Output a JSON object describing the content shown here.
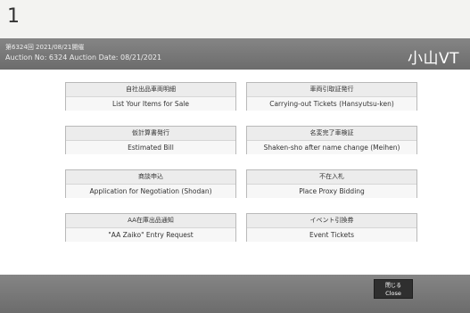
{
  "page_number": "1",
  "header": {
    "line1": "第6324回 2021/08/21開催",
    "line2": "Auction No: 6324   Auction Date: 08/21/2021",
    "venue": "小山VT"
  },
  "menu": {
    "items": [
      {
        "jp": "自社出品車両明細",
        "en": "List Your Items for Sale"
      },
      {
        "jp": "車両引取証発行",
        "en": "Carrying-out Tickets (Hansyutsu-ken)"
      },
      {
        "jp": "仮計算書発行",
        "en": "Estimated Bill"
      },
      {
        "jp": "名変完了車検証",
        "en": "Shaken-sho after name change (Meihen)"
      },
      {
        "jp": "商談申込",
        "en": "Application for Negotiation (Shodan)"
      },
      {
        "jp": "不在入札",
        "en": "Place Proxy Bidding"
      },
      {
        "jp": "AA在庫出品通知",
        "en": "\"AA Zaiko\" Entry Request"
      },
      {
        "jp": "イベント引換券",
        "en": "Event Tickets"
      }
    ]
  },
  "footer": {
    "close_jp": "閉じる",
    "close_en": "Close"
  }
}
